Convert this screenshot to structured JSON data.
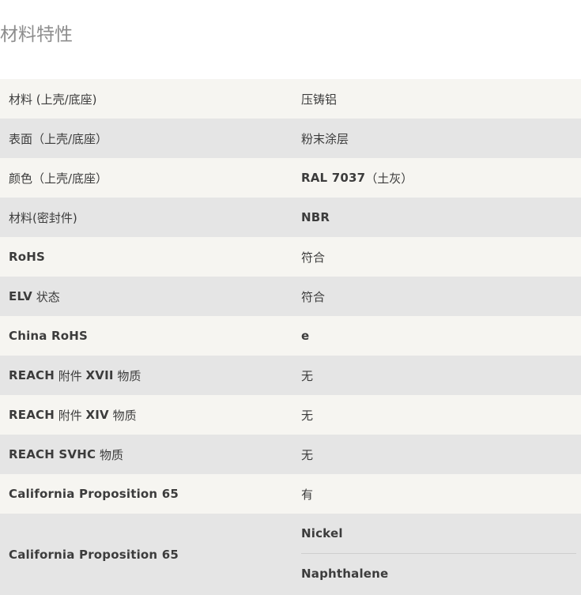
{
  "section": {
    "title": "材料特性"
  },
  "rows": [
    {
      "label": "材料 (上壳/底座)",
      "value": "压铸铝"
    },
    {
      "label": "表面（上壳/底座）",
      "value": "粉末涂层"
    },
    {
      "label": "颜色（上壳/底座）",
      "value_strong": "RAL 7037",
      "value_rest": "（土灰）"
    },
    {
      "label": "材料(密封件)",
      "value_strong": "NBR"
    },
    {
      "label_strong": "RoHS",
      "value": "符合"
    },
    {
      "label_strong": "ELV",
      "label_rest": " 状态",
      "value": "符合"
    },
    {
      "label_strong": "China RoHS",
      "value_strong": "e"
    },
    {
      "label_strong": "REACH",
      "label_rest": " 附件 ",
      "label_strong2": "XVII",
      "label_rest2": " 物质",
      "value": "无"
    },
    {
      "label_strong": "REACH",
      "label_rest": " 附件 ",
      "label_strong2": "XIV",
      "label_rest2": " 物质",
      "value": "无"
    },
    {
      "label_strong": "REACH SVHC",
      "label_rest": " 物质",
      "value": "无"
    },
    {
      "label_strong": "California Proposition 65",
      "value": "有"
    },
    {
      "label_strong": "California Proposition 65",
      "values": [
        "Nickel",
        "Naphthalene"
      ]
    }
  ]
}
